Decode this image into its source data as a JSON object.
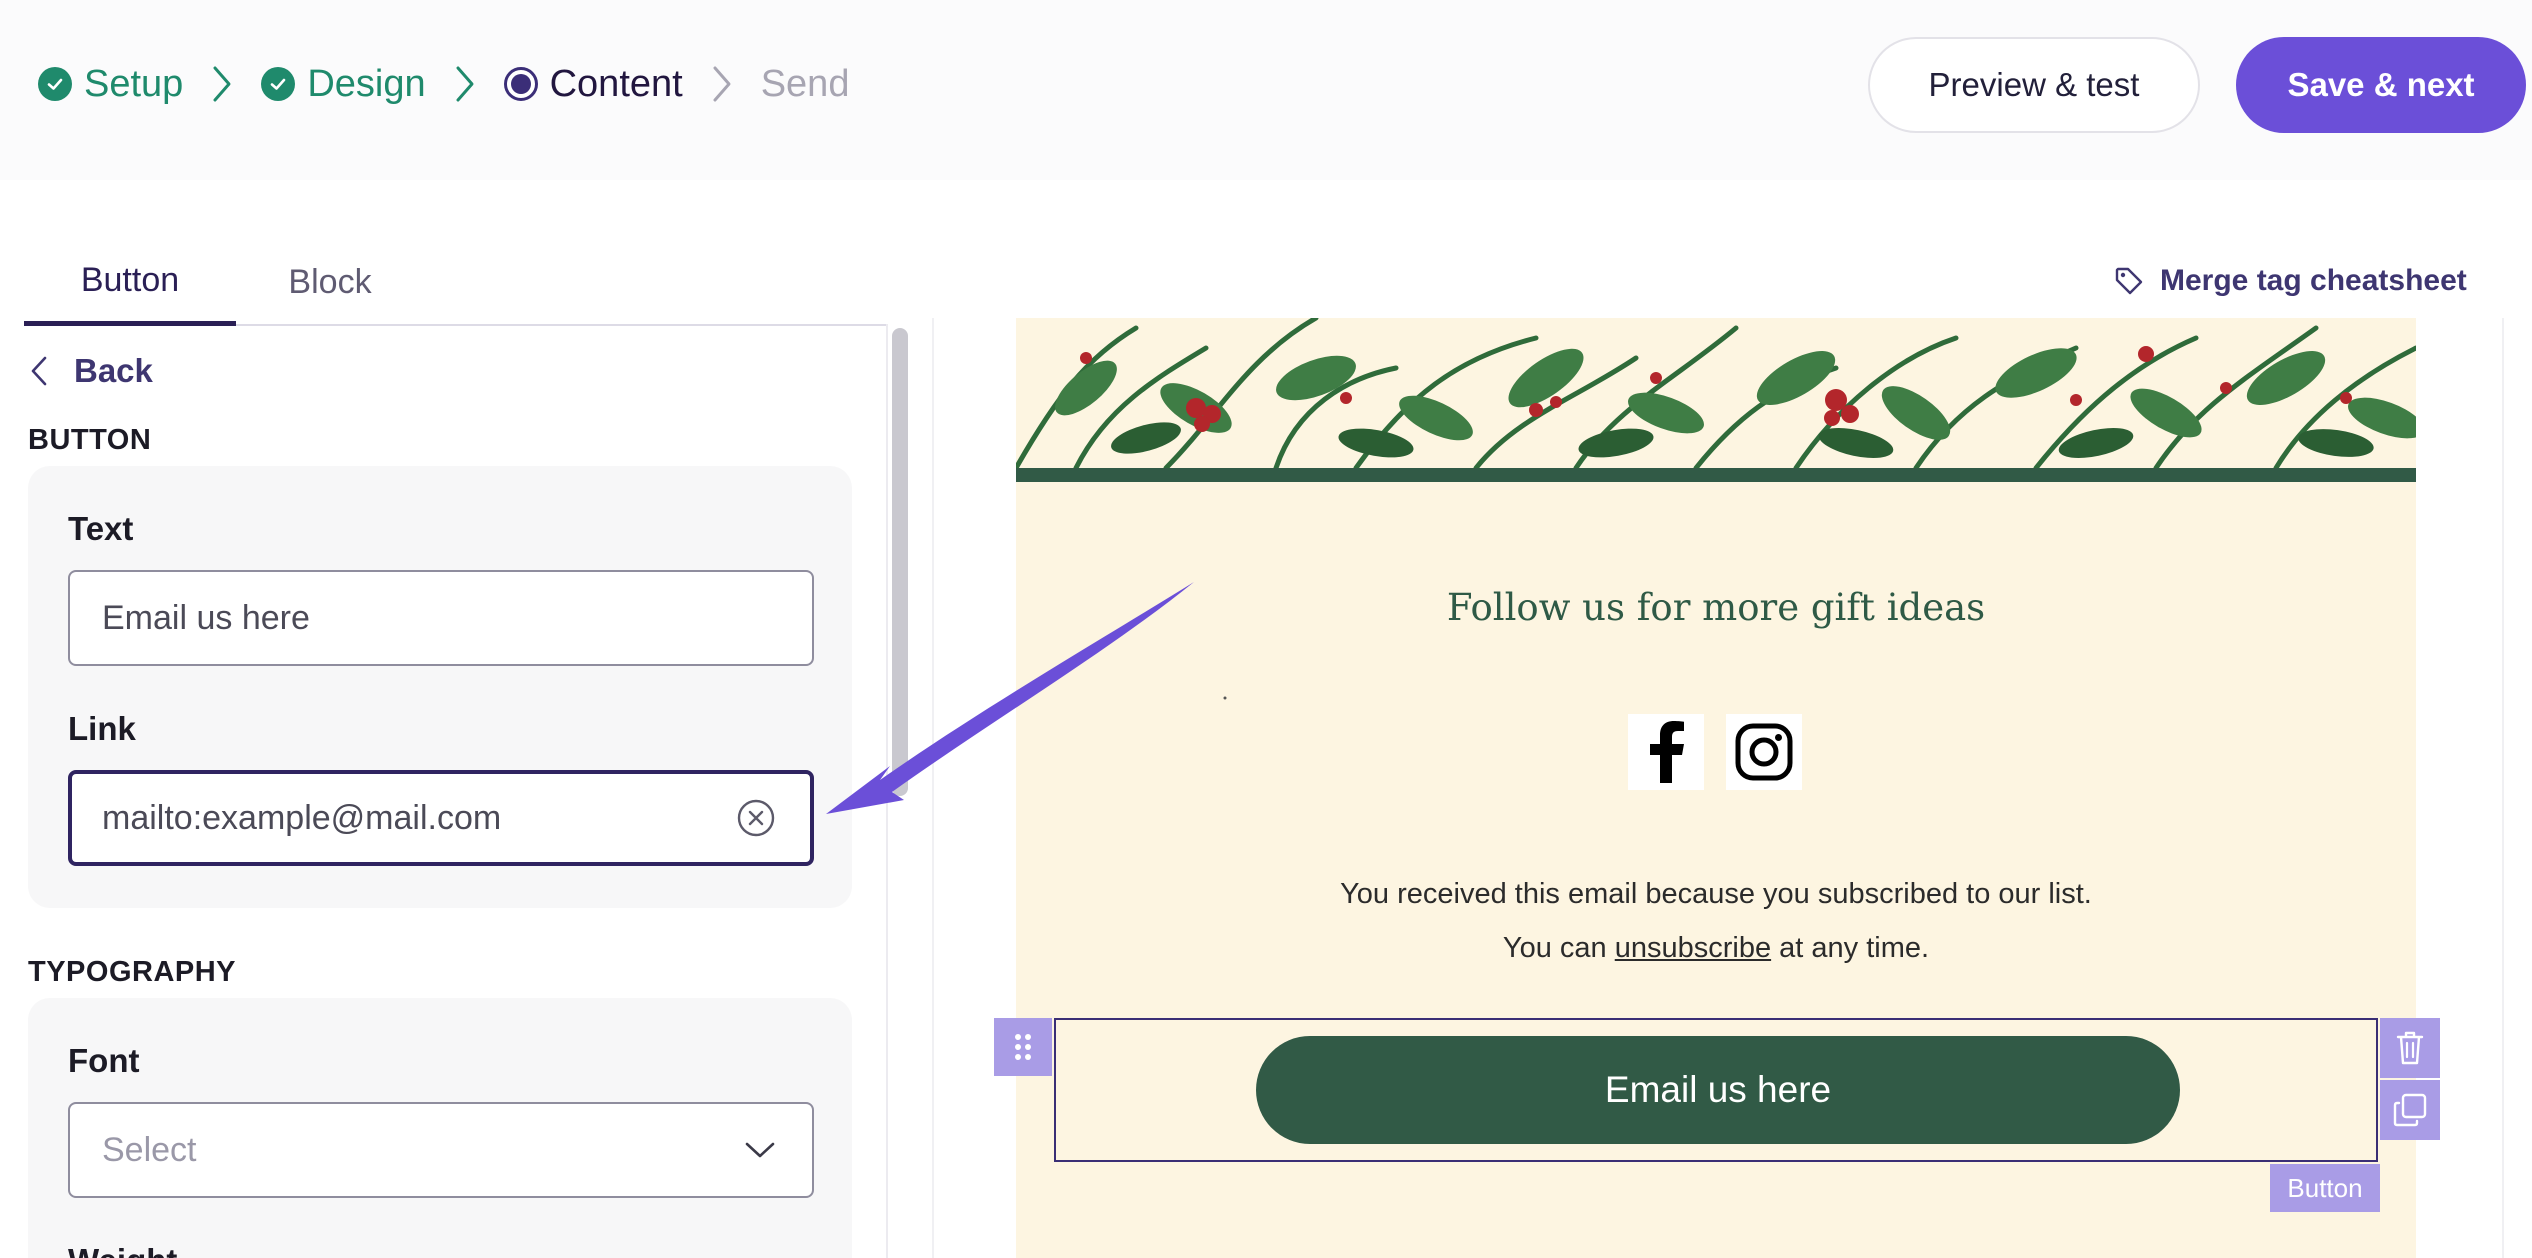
{
  "steps": [
    {
      "label": "Setup",
      "state": "done"
    },
    {
      "label": "Design",
      "state": "done"
    },
    {
      "label": "Content",
      "state": "current"
    },
    {
      "label": "Send",
      "state": "todo"
    }
  ],
  "header": {
    "preview_label": "Preview & test",
    "save_label": "Save & next"
  },
  "tabs": [
    {
      "label": "Button",
      "active": true
    },
    {
      "label": "Block",
      "active": false
    }
  ],
  "merge_tag_label": "Merge tag cheatsheet",
  "panel": {
    "back_label": "Back",
    "button_section": "BUTTON",
    "text_label": "Text",
    "text_value": "Email us here",
    "link_label": "Link",
    "link_value": "mailto:example@mail.com",
    "typography_section": "TYPOGRAPHY",
    "font_label": "Font",
    "font_placeholder": "Select",
    "weight_label": "Weight"
  },
  "email": {
    "follow_text": "Follow us for more gift ideas",
    "notice_line1": "You received this email because you subscribed to our list.",
    "notice_line2_before": "You can ",
    "notice_line2_link": "unsubscribe",
    "notice_line2_after": " at any time.",
    "button_text": "Email us here",
    "block_tag": "Button"
  },
  "colors": {
    "accent": "#6b4fd8",
    "done": "#1f8a6c",
    "email_green": "#315a46",
    "email_bg": "#fdf5e1",
    "selection": "#a99ce6"
  }
}
